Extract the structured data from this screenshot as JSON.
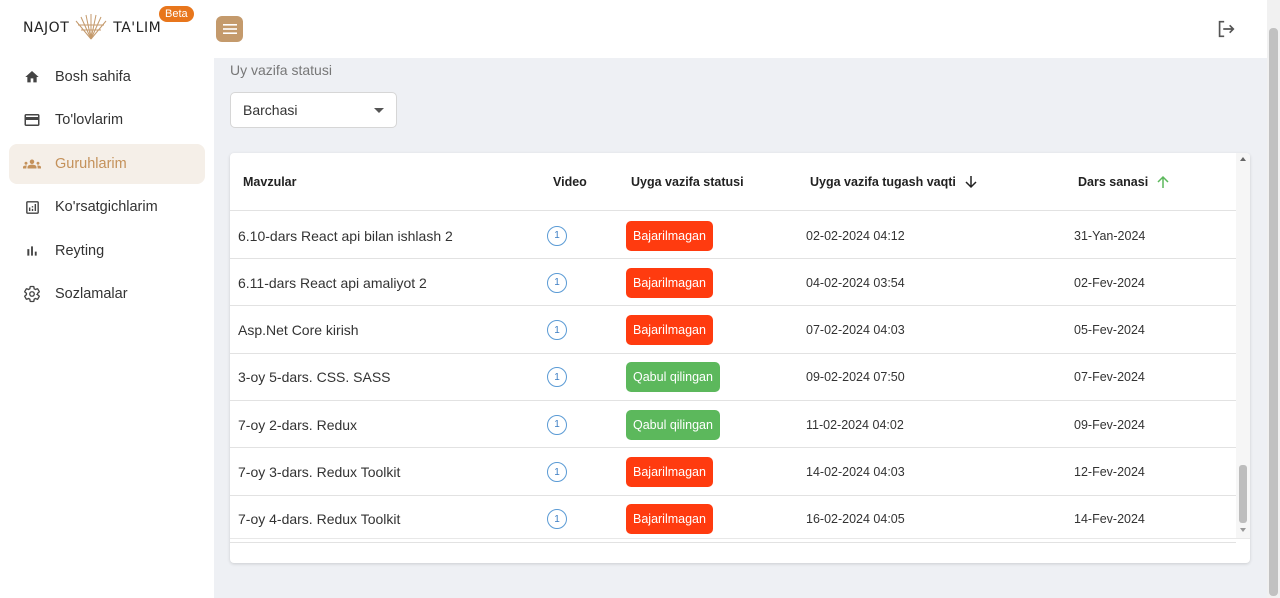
{
  "app": {
    "logo_left": "NAJOT",
    "logo_right": "TA'LIM",
    "beta": "Beta"
  },
  "sidebar": {
    "items": [
      {
        "label": "Bosh sahifa",
        "icon": "home-icon"
      },
      {
        "label": "To'lovlarim",
        "icon": "credit-card-icon"
      },
      {
        "label": "Guruhlarim",
        "icon": "groups-icon",
        "active": true
      },
      {
        "label": "Ko'rsatgichlarim",
        "icon": "analytics-icon"
      },
      {
        "label": "Reyting",
        "icon": "bar-chart-icon"
      },
      {
        "label": "Sozlamalar",
        "icon": "gear-icon"
      }
    ]
  },
  "filter": {
    "label": "Uy vazifa statusi",
    "value": "Barchasi"
  },
  "table": {
    "headers": {
      "topic": "Mavzular",
      "video": "Video",
      "status": "Uyga vazifa statusi",
      "deadline": "Uyga vazifa tugash vaqti",
      "date": "Dars sanasi"
    },
    "rows": [
      {
        "topic": "6.10-dars React api bilan ishlash 2",
        "video": "1",
        "status": "Bajarilmagan",
        "deadline": "02-02-2024 04:12",
        "date": "31-Yan-2024"
      },
      {
        "topic": "6.11-dars React api amaliyot 2",
        "video": "1",
        "status": "Bajarilmagan",
        "deadline": "04-02-2024 03:54",
        "date": "02-Fev-2024"
      },
      {
        "topic": "Asp.Net Core kirish",
        "video": "1",
        "status": "Bajarilmagan",
        "deadline": "07-02-2024 04:03",
        "date": "05-Fev-2024"
      },
      {
        "topic": "3-oy 5-dars. CSS. SASS",
        "video": "1",
        "status": "Qabul qilingan",
        "deadline": "09-02-2024 07:50",
        "date": "07-Fev-2024"
      },
      {
        "topic": "7-oy 2-dars. Redux",
        "video": "1",
        "status": "Qabul qilingan",
        "deadline": "11-02-2024 04:02",
        "date": "09-Fev-2024"
      },
      {
        "topic": "7-oy 3-dars. Redux Toolkit",
        "video": "1",
        "status": "Bajarilmagan",
        "deadline": "14-02-2024 04:03",
        "date": "12-Fev-2024"
      },
      {
        "topic": "7-oy 4-dars. Redux Toolkit",
        "video": "1",
        "status": "Bajarilmagan",
        "deadline": "16-02-2024 04:05",
        "date": "14-Fev-2024"
      }
    ]
  },
  "colors": {
    "accent": "#c4915a",
    "status_fail": "#ff3b0f",
    "status_ok": "#5cb85c"
  }
}
